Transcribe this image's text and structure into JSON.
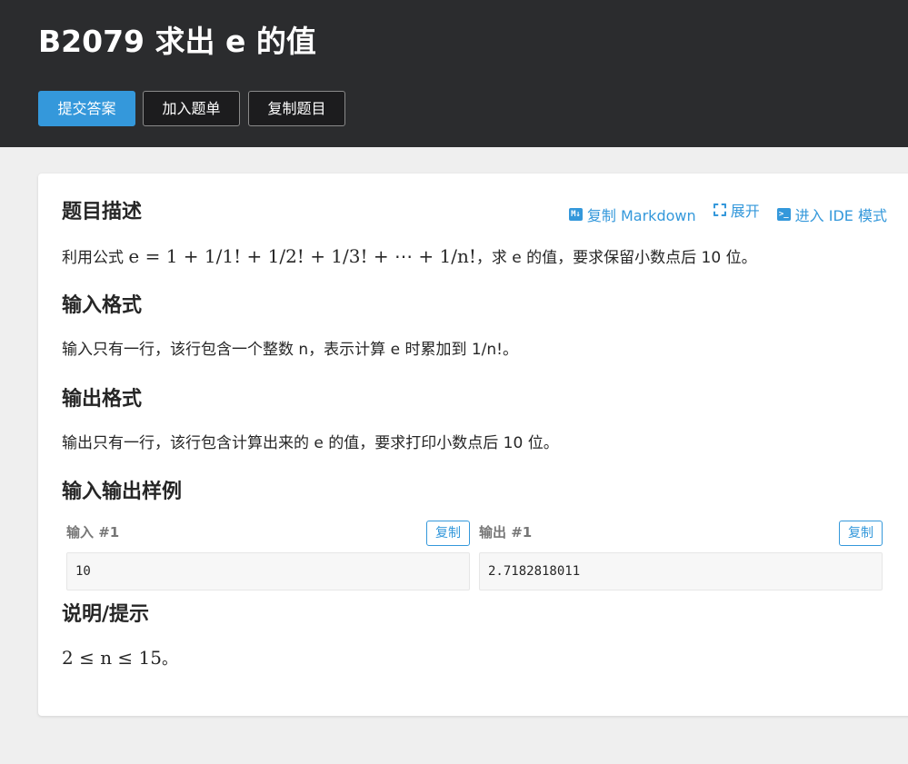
{
  "header": {
    "title": "B2079 求出 e 的值",
    "buttons": {
      "submit": "提交答案",
      "add_to_list": "加入题单",
      "copy_problem": "复制题目"
    }
  },
  "toolbar": {
    "markdown": "复制 Markdown",
    "expand": "展开",
    "ide": "进入 IDE 模式"
  },
  "sections": {
    "description": {
      "heading": "题目描述",
      "text_before": "利用公式",
      "formula": "e = 1 + 1/1! + 1/2! + 1/3! + ⋯ + 1/n!",
      "text_after": "，求 e 的值，要求保留小数点后 10 位。"
    },
    "input_format": {
      "heading": "输入格式",
      "text": "输入只有一行，该行包含一个整数 n，表示计算 e 时累加到 1/n!。"
    },
    "output_format": {
      "heading": "输出格式",
      "text": "输出只有一行，该行包含计算出来的 e 的值，要求打印小数点后 10 位。"
    },
    "samples": {
      "heading": "输入输出样例",
      "input_label": "输入 #1",
      "output_label": "输出 #1",
      "copy_label": "复制",
      "input_value": "10",
      "output_value": "2.7182818011"
    },
    "hint": {
      "heading": "说明/提示",
      "formula": "2 ≤ n ≤ 15",
      "suffix": "。"
    }
  },
  "colors": {
    "header_bg": "#2b2c2e",
    "accent": "#3498db",
    "page_bg": "#efefef"
  }
}
